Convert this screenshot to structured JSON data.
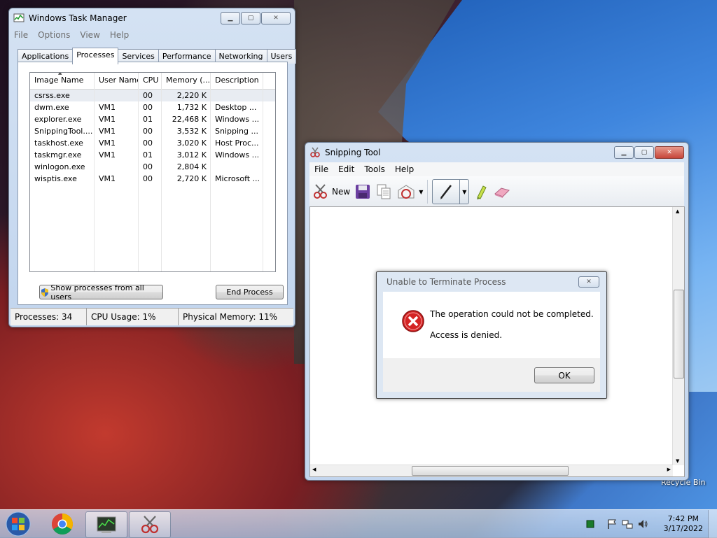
{
  "taskmanager": {
    "title": "Windows Task Manager",
    "menu": [
      "File",
      "Options",
      "View",
      "Help"
    ],
    "tabs": [
      "Applications",
      "Processes",
      "Services",
      "Performance",
      "Networking",
      "Users"
    ],
    "active_tab": "Processes",
    "columns": [
      "Image Name",
      "User Name",
      "CPU",
      "Memory (...",
      "Description"
    ],
    "rows": [
      {
        "image": "csrss.exe",
        "user": "",
        "cpu": "00",
        "memory": "2,220 K",
        "desc": ""
      },
      {
        "image": "dwm.exe",
        "user": "VM1",
        "cpu": "00",
        "memory": "1,732 K",
        "desc": "Desktop ..."
      },
      {
        "image": "explorer.exe",
        "user": "VM1",
        "cpu": "01",
        "memory": "22,468 K",
        "desc": "Windows ..."
      },
      {
        "image": "SnippingTool....",
        "user": "VM1",
        "cpu": "00",
        "memory": "3,532 K",
        "desc": "Snipping ..."
      },
      {
        "image": "taskhost.exe",
        "user": "VM1",
        "cpu": "00",
        "memory": "3,020 K",
        "desc": "Host Proc..."
      },
      {
        "image": "taskmgr.exe",
        "user": "VM1",
        "cpu": "01",
        "memory": "3,012 K",
        "desc": "Windows ..."
      },
      {
        "image": "winlogon.exe",
        "user": "",
        "cpu": "00",
        "memory": "2,804 K",
        "desc": ""
      },
      {
        "image": "wisptis.exe",
        "user": "VM1",
        "cpu": "00",
        "memory": "2,720 K",
        "desc": "Microsoft ..."
      }
    ],
    "show_all_label": "Show processes from all users",
    "end_process_label": "End Process",
    "status": {
      "processes": "Processes: 34",
      "cpu": "CPU Usage: 1%",
      "memory": "Physical Memory: 11%"
    }
  },
  "snipping": {
    "title": "Snipping Tool",
    "menu": [
      "File",
      "Edit",
      "Tools",
      "Help"
    ],
    "new_label": "New"
  },
  "dialog": {
    "title": "Unable to Terminate Process",
    "message": "The operation could not be completed.",
    "detail": "Access is denied.",
    "ok_label": "OK"
  },
  "desktop": {
    "recycle_bin": "Recycle Bin"
  },
  "taskbar": {
    "time": "7:42 PM",
    "date": "3/17/2022"
  },
  "colors": {
    "error_red": "#d42424",
    "selection": "#e8ecf2",
    "taskbar": "#c8d8ec"
  }
}
